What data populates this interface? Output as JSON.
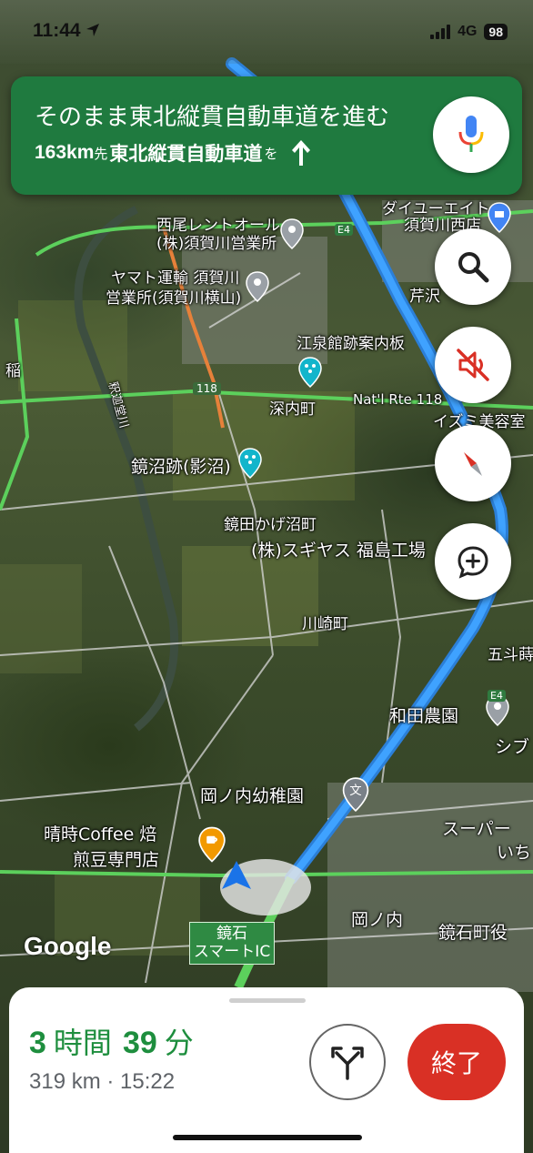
{
  "status": {
    "time": "11:44",
    "network": "4G",
    "battery": "98"
  },
  "banner": {
    "instruction": "そのまま東北縦貫自動車道を進む",
    "next_distance": "163km",
    "next_suffix": "先",
    "next_road": "東北縦貫自動車道",
    "next_particle": "を"
  },
  "map": {
    "labels": {
      "l1": "西尾レントオール",
      "l2": "(株)須賀川営業所",
      "l3": "ヤマト運輸 須賀川",
      "l4": "営業所(須賀川横山)",
      "l5": "江泉館跡案内板",
      "l6": "深内町",
      "l7": "Nat'l Rte 118",
      "l8": "118",
      "l9": "鏡沼跡(影沼)",
      "l10": "鏡田かげ沼町",
      "l11": "(株)スギヤス 福島工場",
      "l12": "川崎町",
      "l13": "和田農園",
      "l14": "岡ノ内幼稚園",
      "l15": "晴時Coffee 焙",
      "l16": "煎豆専門店",
      "l17": "岡ノ内",
      "l18": "鏡石町役",
      "l19": "ダイユーエイト",
      "l20": "須賀川西店",
      "l21": "芹沢",
      "l22": "イズミ美容室",
      "l23": "五斗蒔",
      "l24": "スーパー",
      "l25": "いち",
      "l26": "シブ",
      "l27": "稲",
      "l28": "E4",
      "l29": "E4",
      "l30": "釈迦堂川"
    },
    "exit_label_1": "鏡石",
    "exit_label_2": "スマートIC",
    "google": "Google"
  },
  "trip": {
    "hours": "3",
    "hours_unit": "時間",
    "minutes": "39",
    "minutes_unit": "分",
    "detail": "319 km · 15:22",
    "exit_label": "終了"
  },
  "colors": {
    "banner": "#1f7a3f",
    "route": "#1a73e8",
    "eta": "#1e8e3e",
    "exit": "#d93025"
  },
  "icons": [
    "location-arrow-icon",
    "mic-icon",
    "straight-arrow-icon",
    "search-icon",
    "sound-off-icon",
    "compass-icon",
    "add-report-icon",
    "alternate-routes-icon",
    "navigation-puck-icon"
  ]
}
